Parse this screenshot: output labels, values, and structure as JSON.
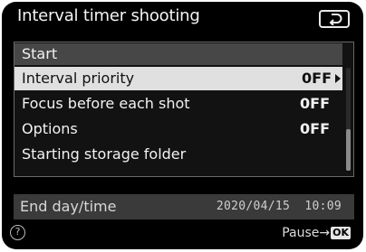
{
  "header": {
    "title": "Interval timer shooting",
    "back_icon": "return-arrow-icon"
  },
  "menu": {
    "start_label": "Start",
    "items": [
      {
        "label": "Interval priority",
        "value": "0FF",
        "selected": true
      },
      {
        "label": "Focus before each shot",
        "value": "0FF"
      },
      {
        "label": "Options",
        "value": "0FF"
      },
      {
        "label": "Starting storage folder",
        "value": ""
      }
    ]
  },
  "end_time": {
    "label": "End day/time",
    "value": "2020/04/15  10:09"
  },
  "footer": {
    "help_glyph": "?",
    "pause_label": "Pause",
    "pause_arrow": "→",
    "ok_label": "OK"
  },
  "colors": {
    "background": "#000000",
    "selected_row": "#e0e0e0",
    "start_row": "#474747",
    "end_bar": "#3a3a3a"
  }
}
